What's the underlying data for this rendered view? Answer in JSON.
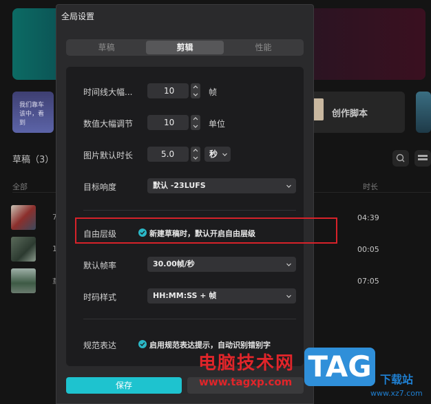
{
  "background": {
    "promo_text": "我们靠车该中，看到",
    "script_label": "创作脚本",
    "drafts_title": "草稿（3）",
    "col_all": "全部",
    "col_duration": "时长",
    "row_fragments": [
      "7",
      "1",
      "草"
    ],
    "durations": [
      "04:39",
      "00:05",
      "07:05"
    ]
  },
  "modal": {
    "title": "全局设置",
    "tabs": [
      {
        "label": "草稿",
        "active": false
      },
      {
        "label": "剪辑",
        "active": true
      },
      {
        "label": "性能",
        "active": false
      }
    ],
    "timeline_zoom": {
      "label": "时间线大幅...",
      "value": "10",
      "unit": "帧"
    },
    "value_step": {
      "label": "数值大幅调节",
      "value": "10",
      "unit": "单位"
    },
    "image_duration": {
      "label": "图片默认时长",
      "value": "5.0",
      "unit": "秒"
    },
    "target_loudness": {
      "label": "目标响度",
      "value": "默认 -23LUFS"
    },
    "free_layer": {
      "label": "自由层级",
      "checkbox_label": "新建草稿时，默认开启自由层级",
      "checked": true
    },
    "default_fps": {
      "label": "默认帧率",
      "value": "30.00帧/秒"
    },
    "timecode_style": {
      "label": "时码样式",
      "value": "HH:MM:SS + 帧"
    },
    "normalization": {
      "label": "规范表达",
      "checkbox_label": "启用规范表达提示，自动识别错别字",
      "checked": true
    },
    "save_label": "保存"
  },
  "colors": {
    "accent": "#1ec3cf",
    "highlight_box": "#d9222a",
    "checkbox": "#2bb7c6"
  },
  "watermark": {
    "text": "电脑技术网",
    "url": "www.tagxp.com",
    "badge": "TAG",
    "side": "下载站",
    "side_url": "www.xz7.com"
  }
}
